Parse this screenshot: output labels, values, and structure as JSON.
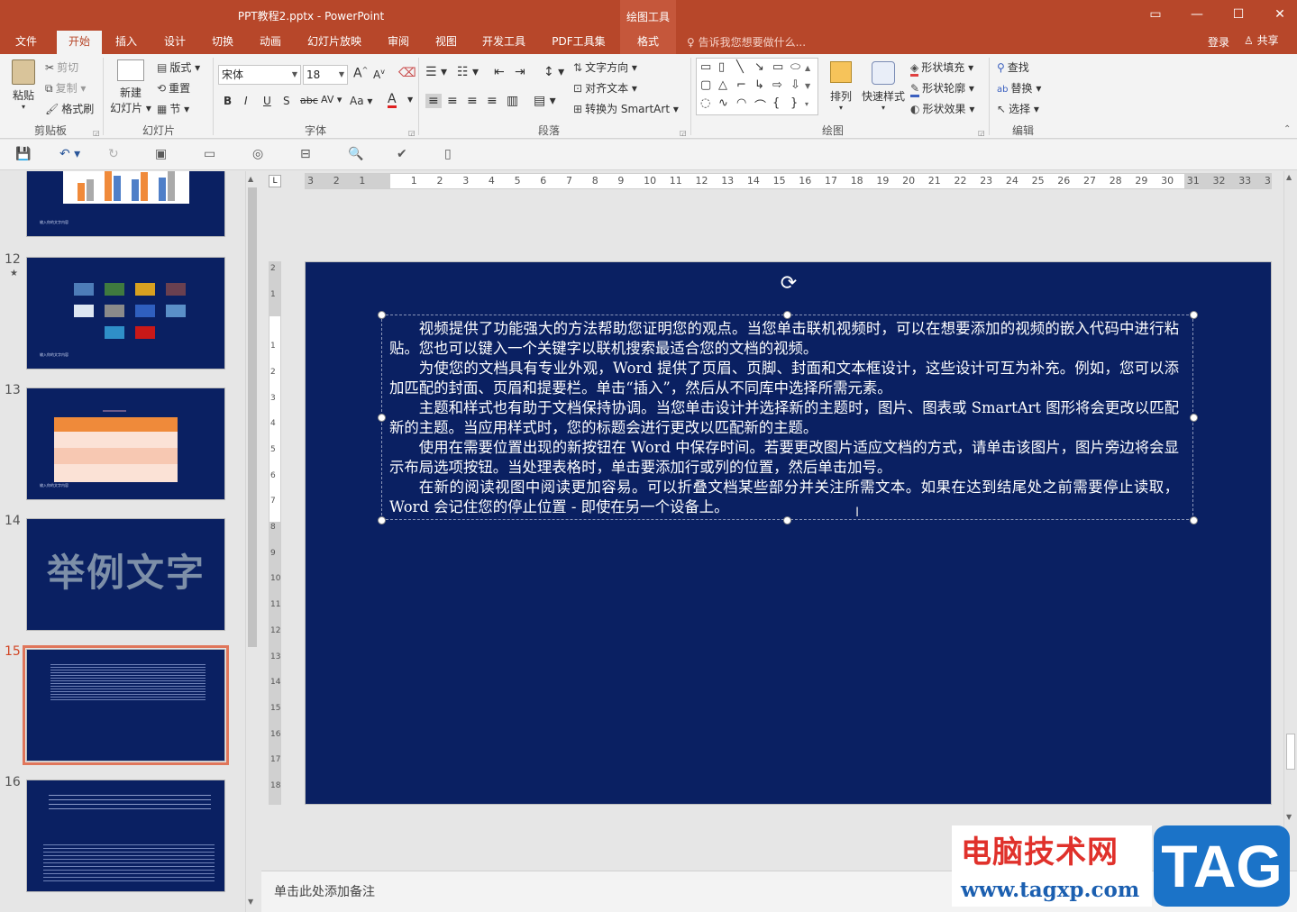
{
  "window": {
    "title": "PPT教程2.pptx - PowerPoint",
    "context_group": "绘图工具",
    "controls": [
      "▭",
      "—",
      "☐",
      "✕"
    ]
  },
  "tabs": [
    "文件",
    "开始",
    "插入",
    "设计",
    "切换",
    "动画",
    "幻灯片放映",
    "审阅",
    "视图",
    "开发工具",
    "PDF工具集",
    "格式"
  ],
  "tell_me": "告诉我您想要做什么...",
  "login": "登录",
  "share": "共享",
  "ribbon": {
    "clipboard": {
      "paste": "粘贴",
      "cut": "剪切",
      "copy": "复制",
      "format_painter": "格式刷",
      "label": "剪贴板"
    },
    "slides": {
      "new_slide_1": "新建",
      "new_slide_2": "幻灯片",
      "layout": "版式",
      "reset": "重置",
      "section": "节",
      "label": "幻灯片"
    },
    "font": {
      "font_name": "宋体",
      "font_size": "18",
      "bold": "B",
      "italic": "I",
      "underline": "U",
      "shadow": "S",
      "strike": "abc",
      "spacing": "AV",
      "case": "Aa",
      "color": "A",
      "label": "字体"
    },
    "paragraph": {
      "text_direction": "文字方向",
      "align_text": "对齐文本",
      "smartart": "转换为 SmartArt",
      "label": "段落"
    },
    "drawing": {
      "arrange": "排列",
      "quick_styles": "快速样式",
      "fill": "形状填充",
      "outline": "形状轮廓",
      "effects": "形状效果",
      "label": "绘图"
    },
    "editing": {
      "find": "查找",
      "replace": "替换",
      "select": "选择",
      "label": "编辑"
    }
  },
  "thumbnails": [
    {
      "num": "",
      "caption": "输入你的文字内容"
    },
    {
      "num": "12",
      "caption": "输入你的文字内容"
    },
    {
      "num": "13",
      "caption": "输入你的文字内容"
    },
    {
      "num": "14",
      "caption": "举例文字"
    },
    {
      "num": "15",
      "caption": ""
    },
    {
      "num": "16",
      "caption": ""
    }
  ],
  "slide_star": "★",
  "slide_text": {
    "paragraphs": [
      "视频提供了功能强大的方法帮助您证明您的观点。当您单击联机视频时，可以在想要添加的视频的嵌入代码中进行粘贴。您也可以键入一个关键字以联机搜索最适合您的文档的视频。",
      "为使您的文档具有专业外观，Word 提供了页眉、页脚、封面和文本框设计，这些设计可互为补充。例如，您可以添加匹配的封面、页眉和提要栏。单击“插入”，然后从不同库中选择所需元素。",
      "主题和样式也有助于文档保持协调。当您单击设计并选择新的主题时，图片、图表或 SmartArt 图形将会更改以匹配新的主题。当应用样式时，您的标题会进行更改以匹配新的主题。",
      "使用在需要位置出现的新按钮在 Word 中保存时间。若要更改图片适应文档的方式，请单击该图片，图片旁边将会显示布局选项按钮。当处理表格时，单击要添加行或列的位置，然后单击加号。",
      "在新的阅读视图中阅读更加容易。可以折叠文档某些部分并关注所需文本。如果在达到结尾处之前需要停止读取，Word 会记住您的停止位置 - 即使在另一个设备上。"
    ]
  },
  "notes_placeholder": "单击此处添加备注",
  "watermark": {
    "site_name": "电脑技术网",
    "url": "www.tagxp.com",
    "tag": "TAG"
  },
  "colors": {
    "accent": "#b7472a",
    "slide_bg": "#0a2062",
    "selection": "#e0765b"
  }
}
